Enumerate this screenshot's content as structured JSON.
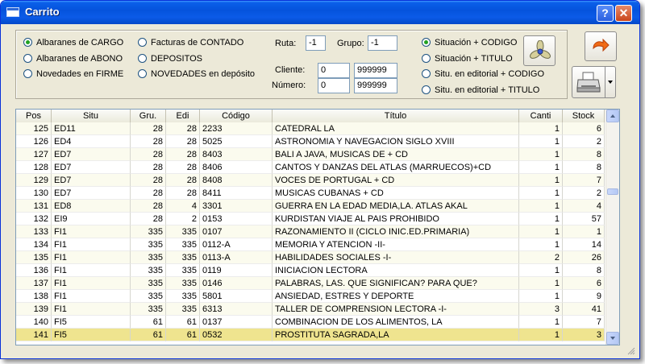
{
  "window": {
    "title": "Carrito",
    "help_label": "?",
    "close_label": "✕",
    "app_icon": "window-icon"
  },
  "options": {
    "col1": [
      {
        "label": "Albaranes de CARGO",
        "checked": true
      },
      {
        "label": "Albaranes de ABONO",
        "checked": false
      },
      {
        "label": "Novedades en FIRME",
        "checked": false
      }
    ],
    "col2": [
      {
        "label": "Facturas de CONTADO",
        "checked": false
      },
      {
        "label": "DEPOSITOS",
        "checked": false
      },
      {
        "label": "NOVEDADES en depósito",
        "checked": false
      }
    ],
    "sort": [
      {
        "label": "Situación + CODIGO",
        "checked": true
      },
      {
        "label": "Situación + TITULO",
        "checked": false
      },
      {
        "label": "Situ. en editorial + CODIGO",
        "checked": false
      },
      {
        "label": "Situ. en editorial + TITULO",
        "checked": false
      }
    ]
  },
  "filters": {
    "ruta_label": "Ruta:",
    "ruta_value": "-1",
    "grupo_label": "Grupo:",
    "grupo_value": "-1",
    "cliente_label": "Cliente:",
    "cliente_from": "0",
    "cliente_to": "999999",
    "numero_label": "Número:",
    "numero_from": "0",
    "numero_to": "999999"
  },
  "toolbar": {
    "fan_icon": "fan-icon",
    "exit_icon": "exit-arrow-icon",
    "print_icon": "printer-icon"
  },
  "table": {
    "headers": [
      "Pos",
      "Situ",
      "Gru.",
      "Edi",
      "Código",
      "Título",
      "Canti",
      "Stock"
    ],
    "rows": [
      [
        "125",
        "ED11",
        "28",
        "28",
        "2233",
        "CATEDRAL LA",
        "1",
        "6"
      ],
      [
        "126",
        "ED4",
        "28",
        "28",
        "5025",
        "ASTRONOMIA Y NAVEGACION SIGLO XVIII",
        "1",
        "2"
      ],
      [
        "127",
        "ED7",
        "28",
        "28",
        "8403",
        "BALI A JAVA, MUSICAS DE + CD",
        "1",
        "8"
      ],
      [
        "128",
        "ED7",
        "28",
        "28",
        "8406",
        "CANTOS Y DANZAS DEL ATLAS (MARRUECOS)+CD",
        "1",
        "8"
      ],
      [
        "129",
        "ED7",
        "28",
        "28",
        "8408",
        "VOCES DE PORTUGAL + CD",
        "1",
        "7"
      ],
      [
        "130",
        "ED7",
        "28",
        "28",
        "8411",
        "MUSICAS CUBANAS + CD",
        "1",
        "2"
      ],
      [
        "131",
        "ED8",
        "28",
        "4",
        "3301",
        "GUERRA EN LA EDAD MEDIA,LA. ATLAS AKAL",
        "1",
        "4"
      ],
      [
        "132",
        "EI9",
        "28",
        "2",
        "0153",
        "KURDISTAN VIAJE AL PAIS PROHIBIDO",
        "1",
        "57"
      ],
      [
        "133",
        "FI1",
        "335",
        "335",
        "0107",
        "RAZONAMIENTO II (CICLO INIC.ED.PRIMARIA)",
        "1",
        "1"
      ],
      [
        "134",
        "FI1",
        "335",
        "335",
        "0112-A",
        "MEMORIA Y ATENCION -II-",
        "1",
        "14"
      ],
      [
        "135",
        "FI1",
        "335",
        "335",
        "0113-A",
        "HABILIDADES SOCIALES -I-",
        "2",
        "26"
      ],
      [
        "136",
        "FI1",
        "335",
        "335",
        "0119",
        "INICIACION LECTORA",
        "1",
        "8"
      ],
      [
        "137",
        "FI1",
        "335",
        "335",
        "0146",
        "PALABRAS, LAS. QUE SIGNIFICAN? PARA QUE?",
        "1",
        "6"
      ],
      [
        "138",
        "FI1",
        "335",
        "335",
        "5801",
        "ANSIEDAD, ESTRES Y DEPORTE",
        "1",
        "9"
      ],
      [
        "139",
        "FI1",
        "335",
        "335",
        "6313",
        "TALLER DE COMPRENSION LECTORA -I-",
        "3",
        "41"
      ],
      [
        "140",
        "FI5",
        "61",
        "61",
        "0137",
        "COMBINACION DE LOS ALIMENTOS, LA",
        "1",
        "7"
      ],
      [
        "141",
        "FI5",
        "61",
        "61",
        "0532",
        "PROSTITUTA SAGRADA,LA",
        "1",
        "3"
      ]
    ],
    "selected_row": 16
  }
}
